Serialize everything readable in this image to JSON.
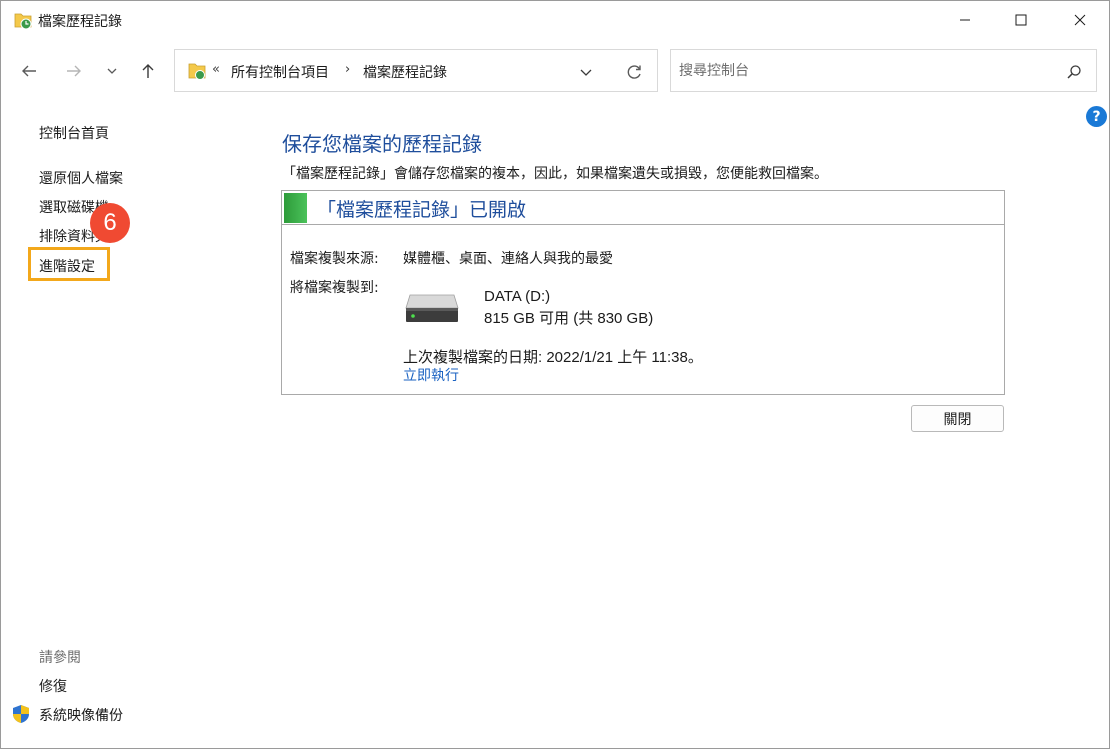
{
  "window": {
    "title": "檔案歷程記錄",
    "icons": {
      "app": "file-history-icon",
      "minimize": "minimize-icon",
      "maximize": "maximize-icon",
      "close": "close-icon"
    }
  },
  "nav": {
    "breadcrumb_prefix": "«",
    "breadcrumb": [
      "所有控制台項目",
      "檔案歷程記錄"
    ],
    "breadcrumb_separator": "›",
    "search_placeholder": "搜尋控制台",
    "help_label": "?",
    "icons": {
      "back": "back-arrow-icon",
      "forward": "forward-arrow-icon",
      "recent": "chevron-down-icon",
      "up": "up-arrow-icon",
      "dropdown": "chevron-down-icon",
      "refresh": "refresh-icon",
      "search": "search-icon",
      "help": "help-icon"
    }
  },
  "sidebar": {
    "items": [
      {
        "label": "控制台首頁"
      },
      {
        "label": "還原個人檔案"
      },
      {
        "label": "選取磁碟機"
      },
      {
        "label": "排除資料夾"
      },
      {
        "label": "進階設定"
      }
    ],
    "see_also_label": "請參閱",
    "see_also_items": [
      {
        "label": "修復"
      },
      {
        "label": "系統映像備份",
        "icon": "shield-icon"
      }
    ]
  },
  "annotation": {
    "step_number": "6",
    "highlight_color": "#f3a81b",
    "badge_color": "#f04a32"
  },
  "main": {
    "title": "保存您檔案的歷程記錄",
    "description": "「檔案歷程記錄」會儲存您檔案的複本，因此，如果檔案遺失或損毀，您便能救回檔案。",
    "status_text": "「檔案歷程記錄」已開啟",
    "status_color": "#2d9b3a",
    "source_label": "檔案複製來源:",
    "source_value": "媒體櫃、桌面、連絡人與我的最愛",
    "target_label": "將檔案複製到:",
    "drive_name": "DATA (D:)",
    "drive_space": "815 GB 可用 (共 830 GB)",
    "drive_icon": "hard-drive-icon",
    "last_copy": "上次複製檔案的日期: 2022/1/21 上午 11:38。",
    "run_now_label": "立即執行",
    "close_button_label": "關閉"
  },
  "colors": {
    "title_blue": "#1f4e9c",
    "link_blue": "#1a62c2"
  }
}
